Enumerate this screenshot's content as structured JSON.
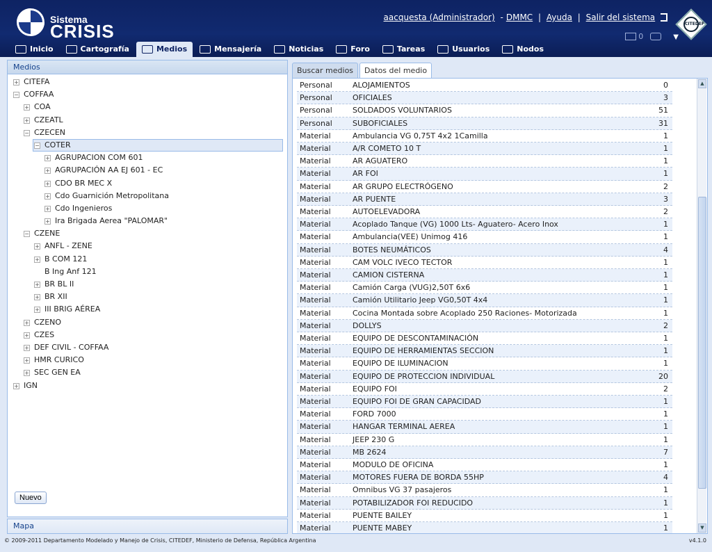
{
  "header": {
    "logo_sub": "Sistema",
    "logo_main": "CRISIS",
    "user": "aacquesta (Administrador)",
    "dash": "-",
    "org": "DMMC",
    "help": "Ayuda",
    "logout": "Salir del sistema",
    "badge_text": "CITEDEF",
    "mail_count": "0"
  },
  "nav": [
    {
      "label": "Inicio",
      "icon": "home-icon",
      "active": false
    },
    {
      "label": "Cartografía",
      "icon": "map-icon",
      "active": false
    },
    {
      "label": "Medios",
      "icon": "resources-icon",
      "active": true
    },
    {
      "label": "Mensajería",
      "icon": "mail-icon",
      "active": false
    },
    {
      "label": "Noticias",
      "icon": "news-icon",
      "active": false
    },
    {
      "label": "Foro",
      "icon": "forum-icon",
      "active": false
    },
    {
      "label": "Tareas",
      "icon": "tasks-icon",
      "active": false
    },
    {
      "label": "Usuarios",
      "icon": "users-icon",
      "active": false
    },
    {
      "label": "Nodos",
      "icon": "nodes-icon",
      "active": false
    }
  ],
  "left_panel": {
    "title": "Medios",
    "new_button": "Nuevo",
    "tree": [
      {
        "label": "CITEFA",
        "depth": 0,
        "toggle": "+"
      },
      {
        "label": "COFFAA",
        "depth": 0,
        "toggle": "-"
      },
      {
        "label": "COA",
        "depth": 1,
        "toggle": "+"
      },
      {
        "label": "CZEATL",
        "depth": 1,
        "toggle": "+"
      },
      {
        "label": "CZECEN",
        "depth": 1,
        "toggle": "-"
      },
      {
        "label": "COTER",
        "depth": 2,
        "toggle": "-",
        "selected": true
      },
      {
        "label": "AGRUPACION COM 601",
        "depth": 3,
        "toggle": "+"
      },
      {
        "label": "AGRUPACIÓN AA EJ 601 - EC",
        "depth": 3,
        "toggle": "+"
      },
      {
        "label": "CDO BR MEC X",
        "depth": 3,
        "toggle": "+"
      },
      {
        "label": "Cdo Guarnición Metropolitana",
        "depth": 3,
        "toggle": "+"
      },
      {
        "label": "Cdo Ingenieros",
        "depth": 3,
        "toggle": "+"
      },
      {
        "label": "Ira Brigada Aerea \"PALOMAR\"",
        "depth": 3,
        "toggle": "+"
      },
      {
        "label": "CZENE",
        "depth": 1,
        "toggle": "-"
      },
      {
        "label": "ANFL - ZENE",
        "depth": 2,
        "toggle": "+"
      },
      {
        "label": "B COM 121",
        "depth": 2,
        "toggle": "+"
      },
      {
        "label": "B Ing Anf 121",
        "depth": 2,
        "toggle": ""
      },
      {
        "label": "BR BL II",
        "depth": 2,
        "toggle": "+"
      },
      {
        "label": "BR XII",
        "depth": 2,
        "toggle": "+"
      },
      {
        "label": "III BRIG AÉREA",
        "depth": 2,
        "toggle": "+"
      },
      {
        "label": "CZENO",
        "depth": 1,
        "toggle": "+"
      },
      {
        "label": "CZES",
        "depth": 1,
        "toggle": "+"
      },
      {
        "label": "DEF CIVIL - COFFAA",
        "depth": 1,
        "toggle": "+"
      },
      {
        "label": "HMR CURICO",
        "depth": 1,
        "toggle": "+"
      },
      {
        "label": "SEC GEN EA",
        "depth": 1,
        "toggle": "+"
      },
      {
        "label": "IGN",
        "depth": 0,
        "toggle": "+"
      }
    ]
  },
  "map_panel": {
    "title": "Mapa"
  },
  "right_panel": {
    "tabs": [
      {
        "label": "Buscar medios",
        "active": false
      },
      {
        "label": "Datos del medio",
        "active": true
      }
    ],
    "rows": [
      {
        "type": "Personal",
        "name": "ALOJAMIENTOS",
        "qty": "0"
      },
      {
        "type": "Personal",
        "name": "OFICIALES",
        "qty": "3"
      },
      {
        "type": "Personal",
        "name": "SOLDADOS VOLUNTARIOS",
        "qty": "51"
      },
      {
        "type": "Personal",
        "name": "SUBOFICIALES",
        "qty": "31"
      },
      {
        "type": "Material",
        "name": "Ambulancia VG 0,75T 4x2 1Camilla",
        "qty": "1"
      },
      {
        "type": "Material",
        "name": "A/R COMETO 10 T",
        "qty": "1"
      },
      {
        "type": "Material",
        "name": "AR AGUATERO",
        "qty": "1"
      },
      {
        "type": "Material",
        "name": "AR FOI",
        "qty": "1"
      },
      {
        "type": "Material",
        "name": "AR GRUPO ELECTRÓGENO",
        "qty": "2"
      },
      {
        "type": "Material",
        "name": "AR PUENTE",
        "qty": "3"
      },
      {
        "type": "Material",
        "name": "AUTOELEVADORA",
        "qty": "2"
      },
      {
        "type": "Material",
        "name": "Acoplado Tanque (VG) 1000 Lts- Aguatero- Acero Inox",
        "qty": "1"
      },
      {
        "type": "Material",
        "name": "Ambulancia(VEE) Unimog 416",
        "qty": "1"
      },
      {
        "type": "Material",
        "name": "BOTES NEUMÁTICOS",
        "qty": "4"
      },
      {
        "type": "Material",
        "name": "CAM VOLC IVECO TECTOR",
        "qty": "1"
      },
      {
        "type": "Material",
        "name": "CAMION CISTERNA",
        "qty": "1"
      },
      {
        "type": "Material",
        "name": "Camión Carga (VUG)2,50T 6x6",
        "qty": "1"
      },
      {
        "type": "Material",
        "name": "Camión Utilitario Jeep VG0,50T 4x4",
        "qty": "1"
      },
      {
        "type": "Material",
        "name": "Cocina Montada sobre Acoplado 250 Raciones- Motorizada",
        "qty": "1"
      },
      {
        "type": "Material",
        "name": "DOLLYS",
        "qty": "2"
      },
      {
        "type": "Material",
        "name": "EQUIPO DE DESCONTAMINACIÓN",
        "qty": "1"
      },
      {
        "type": "Material",
        "name": "EQUIPO DE HERRAMIENTAS SECCION",
        "qty": "1"
      },
      {
        "type": "Material",
        "name": "EQUIPO DE ILUMINACION",
        "qty": "1"
      },
      {
        "type": "Material",
        "name": "EQUIPO DE PROTECCION INDIVIDUAL",
        "qty": "20"
      },
      {
        "type": "Material",
        "name": "EQUIPO FOI",
        "qty": "2"
      },
      {
        "type": "Material",
        "name": "EQUIPO FOI DE GRAN CAPACIDAD",
        "qty": "1"
      },
      {
        "type": "Material",
        "name": "FORD 7000",
        "qty": "1"
      },
      {
        "type": "Material",
        "name": "HANGAR TERMINAL AEREA",
        "qty": "1"
      },
      {
        "type": "Material",
        "name": "JEEP 230 G",
        "qty": "1"
      },
      {
        "type": "Material",
        "name": "MB 2624",
        "qty": "7"
      },
      {
        "type": "Material",
        "name": "MODULO DE OFICINA",
        "qty": "1"
      },
      {
        "type": "Material",
        "name": "MOTORES FUERA DE BORDA 55HP",
        "qty": "4"
      },
      {
        "type": "Material",
        "name": "Omnibus VG 37 pasajeros",
        "qty": "1"
      },
      {
        "type": "Material",
        "name": "POTABILIZADOR FOI REDUCIDO",
        "qty": "1"
      },
      {
        "type": "Material",
        "name": "PUENTE BAILEY",
        "qty": "1"
      },
      {
        "type": "Material",
        "name": "PUENTE MABEY",
        "qty": "1"
      }
    ]
  },
  "footer": {
    "copyright": "© 2009-2011 Departamento Modelado y Manejo de Crisis, CITEDEF, Ministerio de Defensa, República Argentina",
    "version": "v4.1.0"
  }
}
